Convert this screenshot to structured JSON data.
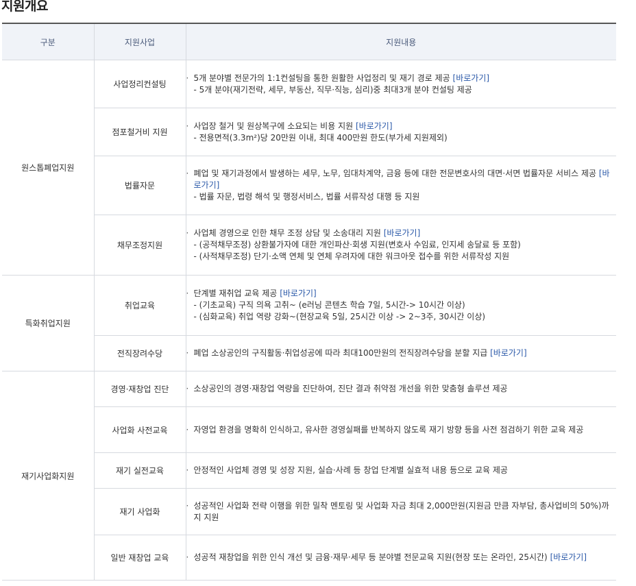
{
  "page_title": "지원개요",
  "headers": {
    "category": "구분",
    "program": "지원사업",
    "content": "지원내용"
  },
  "categories": [
    {
      "name": "원스톱폐업지원",
      "rows": [
        {
          "program": "사업정리컨설팅",
          "main": "5개 분야별 전문가의 1:1컨설팅을 통한 원활한 사업정리 및 재기 경로 제공",
          "link": "[바로가기]",
          "subs": [
            "- 5개 분야(재기전략, 세무, 부동산, 직무·직능, 심리)중 최대3개 분야 컨설팅 제공"
          ]
        },
        {
          "program": "점포철거비 지원",
          "main": "사업장 철거 및 원상복구에 소요되는 비용 지원",
          "link": "[바로가기]",
          "subs": [
            "- 전용면적(3.3m²)당 20만원 이내, 최대 400만원 한도(부가세 지원제외)"
          ]
        },
        {
          "program": "법률자문",
          "main": "폐업 및 재기과정에서 발생하는 세무, 노무, 임대차계약, 금융 등에 대한 전문변호사의 대면·서면 법률자문 서비스 제공",
          "link": "[바로가기]",
          "subs": [
            "- 법률 자문, 법령 해석 및 행정서비스, 법률 서류작성 대행 등 지원"
          ]
        },
        {
          "program": "채무조정지원",
          "main": "사업체 경영으로 인한 채무 조정 상담 및 소송대리 지원",
          "link": "[바로가기]",
          "subs": [
            "- (공적채무조정) 상환불가자에 대한 개인파산·회생 지원(변호사 수임료, 인지세 송달료 등 포함)",
            "- (사적채무조정) 단기·소액 연체 및 연체 우려자에 대한 워크아웃 접수를 위한 서류작성 지원"
          ]
        }
      ]
    },
    {
      "name": "특화취업지원",
      "rows": [
        {
          "program": "취업교육",
          "main": "단계별 재취업 교육 제공",
          "link": "[바로가기]",
          "subs": [
            "- (기초교육) 구직 의욕 고취~ (e러닝 콘텐츠 학습 7일, 5시간-> 10시간 이상)",
            "- (심화교육) 취업 역량 강화~(현장교육 5일, 25시간 이상 -> 2~3주, 30시간 이상)"
          ]
        },
        {
          "program": "전직장려수당",
          "main": "폐업 소상공인의 구직활동·취업성공에 따라 최대100만원의 전직장려수당을 분할 지급",
          "link": "[바로가기]",
          "subs": []
        }
      ]
    },
    {
      "name": "재기사업화지원",
      "rows": [
        {
          "program": "경영·재창업 진단",
          "main": "소상공인의 경영·재창업 역량을 진단하여, 진단 결과 취약점 개선을 위한 맞춤형 솔루션 제공",
          "link": "",
          "subs": []
        },
        {
          "program": "사업화 사전교육",
          "main": "자영업 환경을 명확히 인식하고, 유사한 경영실패를 반복하지 않도록 재기 방향 등을 사전 점검하기 위한 교육 제공",
          "link": "",
          "subs": []
        },
        {
          "program": "재기 실전교육",
          "main": "안정적인 사업체 경영 및 성장 지원, 실습·사례 등 창업 단계별 실효적 내용 등으로 교육 제공",
          "link": "",
          "subs": []
        },
        {
          "program": "재기 사업화",
          "main": "성공적인 사업화 전략 이행을 위한 밀착 멘토링 및 사업화 자금 최대 2,000만원(지원금 만큼 자부담, 총사업비의 50%)까지 지원",
          "link": "",
          "subs": []
        },
        {
          "program": "일반 재창업 교육",
          "main": "성공적 재창업을 위한 인식 개선 및 금융·재무·세무 등 분야별 전문교육 지원(현장 또는 온라인, 25시간)",
          "link": "[바로가기]",
          "subs": []
        }
      ]
    }
  ]
}
